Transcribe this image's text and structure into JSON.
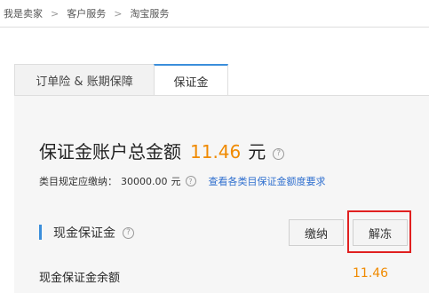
{
  "breadcrumb": {
    "items": [
      "我是卖家",
      "客户服务",
      "淘宝服务"
    ],
    "separator": ">"
  },
  "tabs": [
    {
      "label": "订单险 & 账期保障",
      "active": false
    },
    {
      "label": "保证金",
      "active": true
    }
  ],
  "summary": {
    "title": "保证金账户总金额",
    "amount": "11.46",
    "unit": "元",
    "help_icon": "question-circle-icon"
  },
  "requirement": {
    "label": "类目规定应缴纳：",
    "amount": "30000.00",
    "unit": "元",
    "link": "查看各类目保证金额度要求"
  },
  "cash_section": {
    "title": "现金保证金",
    "pay_button": "缴纳",
    "thaw_button": "解冻"
  },
  "balance": {
    "label": "现金保证金余额",
    "value": "11.46"
  },
  "colors": {
    "accent_blue": "#3b8edb",
    "link_blue": "#2f6fcf",
    "amount_orange": "#f08a00",
    "highlight_red": "#e02020"
  }
}
